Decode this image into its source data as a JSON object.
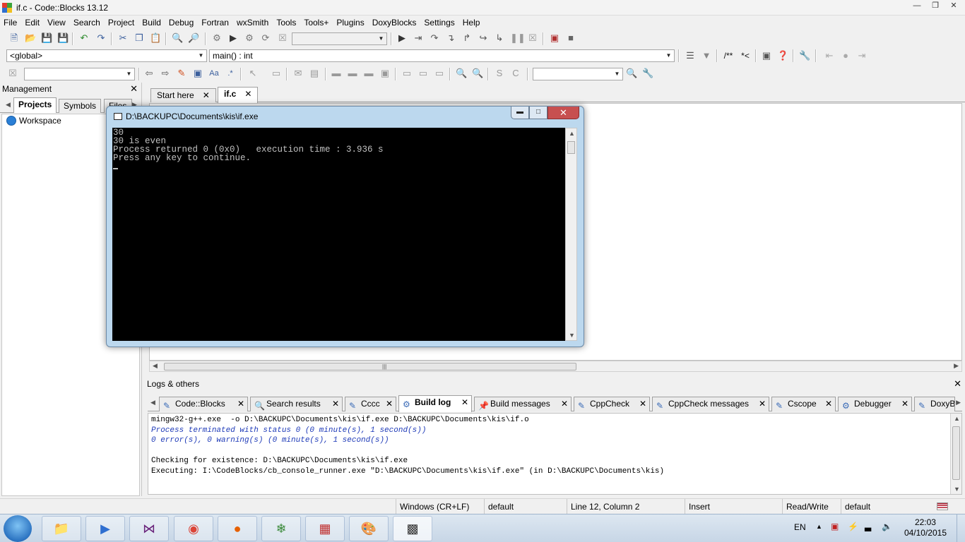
{
  "window": {
    "title": "if.c - Code::Blocks 13.12"
  },
  "menu": [
    "File",
    "Edit",
    "View",
    "Search",
    "Project",
    "Build",
    "Debug",
    "Fortran",
    "wxSmith",
    "Tools",
    "Tools+",
    "Plugins",
    "DoxyBlocks",
    "Settings",
    "Help"
  ],
  "code_toolbar": {
    "scope": "<global>",
    "function": "main() : int",
    "doxy_comment": "/**",
    "doxy_line": "*<"
  },
  "management": {
    "title": "Management",
    "tabs": [
      "Projects",
      "Symbols",
      "Files"
    ],
    "tree": [
      "Workspace"
    ]
  },
  "editor": {
    "tabs": [
      {
        "label": "Start here",
        "active": false
      },
      {
        "label": "if.c",
        "active": true
      }
    ]
  },
  "console": {
    "title": "D:\\BACKUPC\\Documents\\kis\\if.exe",
    "lines": [
      "30",
      "30 is even",
      "Process returned 0 (0x0)   execution time : 3.936 s",
      "Press any key to continue."
    ]
  },
  "logs": {
    "title": "Logs & others",
    "tabs": [
      {
        "label": "Code::Blocks",
        "icon": "doc",
        "active": false
      },
      {
        "label": "Search results",
        "icon": "search",
        "active": false
      },
      {
        "label": "Cccc",
        "icon": "doc",
        "active": false
      },
      {
        "label": "Build log",
        "icon": "gear",
        "active": true
      },
      {
        "label": "Build messages",
        "icon": "pin",
        "active": false
      },
      {
        "label": "CppCheck",
        "icon": "doc",
        "active": false
      },
      {
        "label": "CppCheck messages",
        "icon": "doc",
        "active": false
      },
      {
        "label": "Cscope",
        "icon": "doc",
        "active": false
      },
      {
        "label": "Debugger",
        "icon": "gear",
        "active": false
      },
      {
        "label": "DoxyB",
        "icon": "doc",
        "active": false
      }
    ],
    "output": [
      {
        "text": "mingw32-g++.exe  -o D:\\BACKUPC\\Documents\\kis\\if.exe D:\\BACKUPC\\Documents\\kis\\if.o",
        "style": "normal"
      },
      {
        "text": "Process terminated with status 0 (0 minute(s), 1 second(s))",
        "style": "blue"
      },
      {
        "text": "0 error(s), 0 warning(s) (0 minute(s), 1 second(s))",
        "style": "blue"
      },
      {
        "text": "",
        "style": "normal"
      },
      {
        "text": "Checking for existence: D:\\BACKUPC\\Documents\\kis\\if.exe",
        "style": "normal"
      },
      {
        "text": "Executing: I:\\CodeBlocks/cb_console_runner.exe \"D:\\BACKUPC\\Documents\\kis\\if.exe\" (in D:\\BACKUPC\\Documents\\kis)",
        "style": "normal"
      }
    ]
  },
  "status": {
    "eol": "Windows (CR+LF)",
    "encoding": "default",
    "position": "Line 12, Column 2",
    "mode": "Insert",
    "access": "Read/Write",
    "profile": "default"
  },
  "taskbar": {
    "language": "EN",
    "time": "22:03",
    "date": "04/10/2015"
  },
  "colors": {
    "console_bg": "#000000",
    "log_blue": "#1f3bb8",
    "close_red": "#c75050"
  }
}
